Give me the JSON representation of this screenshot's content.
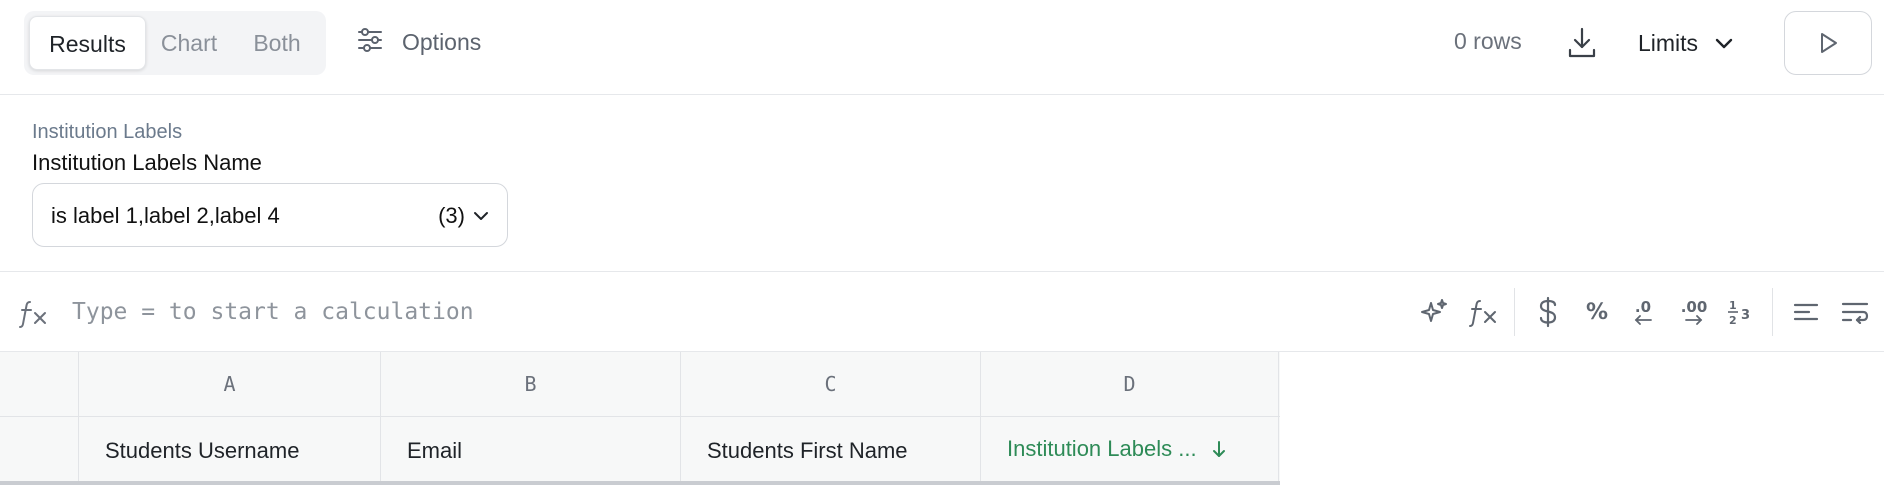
{
  "toolbar": {
    "view_tabs": [
      {
        "label": "Results",
        "active": true
      },
      {
        "label": "Chart",
        "active": false
      },
      {
        "label": "Both",
        "active": false
      }
    ],
    "options_label": "Options",
    "rows_count": "0 rows",
    "limits_label": "Limits",
    "icons": {
      "options": "sliders-icon",
      "download": "download-icon",
      "limits": "chevron-down-icon",
      "run": "play-icon"
    }
  },
  "filter": {
    "section_label": "Institution Labels",
    "field_label": "Institution Labels Name",
    "value": "is label 1,label 2,label 4",
    "count": "(3)"
  },
  "formula_bar": {
    "placeholder": "Type = to start a calculation",
    "tools": {
      "percent": "%",
      "decrease_decimals": ".0",
      "increase_decimals": ".00"
    }
  },
  "grid": {
    "columns": [
      {
        "letter": "A",
        "field": "Students Username",
        "sorted": false
      },
      {
        "letter": "B",
        "field": "Email",
        "sorted": false
      },
      {
        "letter": "C",
        "field": "Students First Name",
        "sorted": false
      },
      {
        "letter": "D",
        "field": "Institution Labels ...",
        "sorted": true,
        "sort_direction": "descending"
      }
    ]
  },
  "colors": {
    "accent_green": "#2e8b57",
    "border": "#e2e4e7",
    "muted_text": "#6b717b"
  }
}
